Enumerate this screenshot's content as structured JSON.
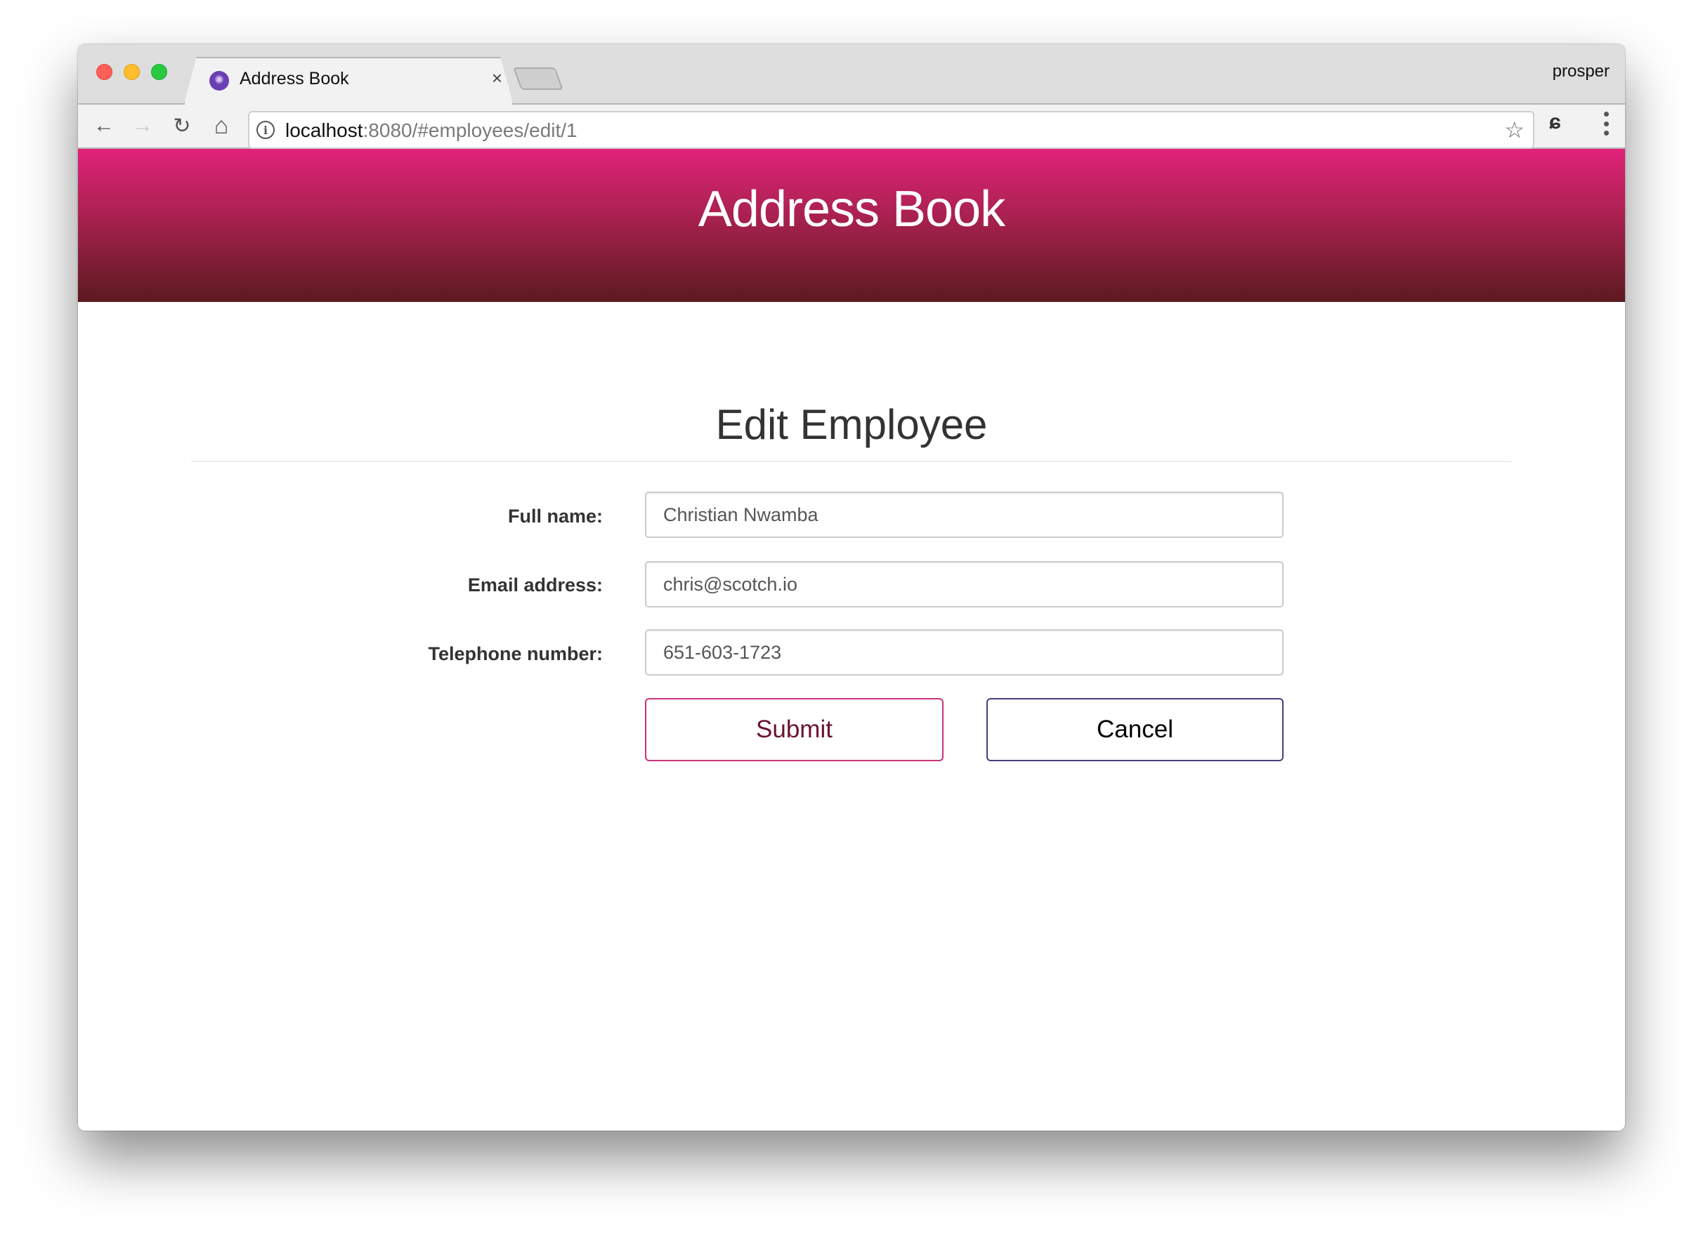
{
  "browser": {
    "tab": {
      "title": "Address Book",
      "favicon": "app-logo-icon",
      "close": "×"
    },
    "profile_name": "prosper",
    "url": {
      "host": "localhost",
      "rest": ":8080/#employees/edit/1"
    },
    "icons": {
      "back": "←",
      "forward": "→",
      "reload": "↻",
      "home": "⌂",
      "info": "i",
      "star": "☆",
      "extension": "ɕ"
    }
  },
  "header": {
    "title": "Address Book"
  },
  "page": {
    "title": "Edit Employee"
  },
  "form": {
    "fields": [
      {
        "label": "Full name:",
        "value": "Christian Nwamba"
      },
      {
        "label": "Email address:",
        "value": "chris@scotch.io"
      },
      {
        "label": "Telephone number:",
        "value": "651-603-1723"
      }
    ],
    "submit_label": "Submit",
    "cancel_label": "Cancel"
  },
  "colors": {
    "header_gradient_top": "#e0237a",
    "header_gradient_bottom": "#5c1a20",
    "submit_border": "#c8347a",
    "submit_text": "#6b1232",
    "cancel_border": "#4a3b7c"
  }
}
